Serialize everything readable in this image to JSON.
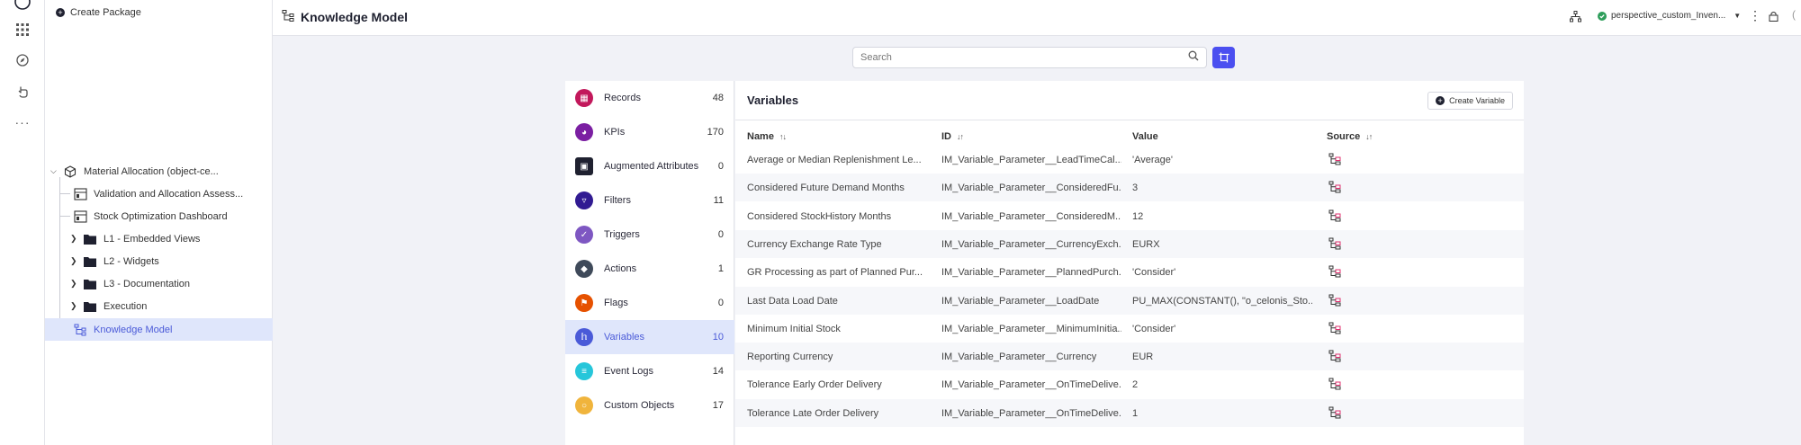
{
  "tree": {
    "create_package": "Create Package",
    "nodes": [
      "Material Allocation (object-ce...",
      "Validation and Allocation Assess...",
      "Stock Optimization Dashboard",
      "L1 - Embedded Views",
      "L2 - Widgets",
      "L3 - Documentation",
      "Execution",
      "Knowledge Model"
    ]
  },
  "header": {
    "title": "Knowledge Model",
    "environment": "perspective_custom_Inven..."
  },
  "search": {
    "placeholder": "Search"
  },
  "categories": [
    {
      "label": "Records",
      "count": "48",
      "color": "#c2185b",
      "icon": "records-icon"
    },
    {
      "label": "KPIs",
      "count": "170",
      "color": "#7b1fa2",
      "icon": "kpi-icon"
    },
    {
      "label": "Augmented Attributes",
      "count": "0",
      "color": "#1f2130",
      "icon": "augmented-attributes-icon"
    },
    {
      "label": "Filters",
      "count": "11",
      "color": "#311b92",
      "icon": "filter-icon"
    },
    {
      "label": "Triggers",
      "count": "0",
      "color": "#7e57c2",
      "icon": "trigger-icon"
    },
    {
      "label": "Actions",
      "count": "1",
      "color": "#3f4a5a",
      "icon": "action-icon"
    },
    {
      "label": "Flags",
      "count": "0",
      "color": "#e65100",
      "icon": "flag-icon"
    },
    {
      "label": "Variables",
      "count": "10",
      "color": "#4a5ad8",
      "icon": "variables-icon"
    },
    {
      "label": "Event Logs",
      "count": "14",
      "color": "#26c6da",
      "icon": "event-log-icon"
    },
    {
      "label": "Custom Objects",
      "count": "17",
      "color": "#f0b43c",
      "icon": "custom-object-icon"
    }
  ],
  "variables": {
    "title": "Variables",
    "create_label": "Create Variable",
    "columns": [
      "Name",
      "ID",
      "Value",
      "Source"
    ],
    "rows": [
      {
        "name": "Average or Median Replenishment Le...",
        "id": "IM_Variable_Parameter__LeadTimeCal...",
        "value": "'Average'"
      },
      {
        "name": "Considered Future Demand Months",
        "id": "IM_Variable_Parameter__ConsideredFu...",
        "value": "3"
      },
      {
        "name": "Considered StockHistory Months",
        "id": "IM_Variable_Parameter__ConsideredM...",
        "value": "12"
      },
      {
        "name": "Currency Exchange Rate Type",
        "id": "IM_Variable_Parameter__CurrencyExch...",
        "value": "EURX"
      },
      {
        "name": "GR Processing as part of Planned Pur...",
        "id": "IM_Variable_Parameter__PlannedPurch...",
        "value": "'Consider'"
      },
      {
        "name": "Last Data Load Date",
        "id": "IM_Variable_Parameter__LoadDate",
        "value": "PU_MAX(CONSTANT(), \"o_celonis_Sto..."
      },
      {
        "name": "Minimum Initial Stock",
        "id": "IM_Variable_Parameter__MinimumInitia...",
        "value": "'Consider'"
      },
      {
        "name": "Reporting Currency",
        "id": "IM_Variable_Parameter__Currency",
        "value": "EUR"
      },
      {
        "name": "Tolerance Early Order Delivery",
        "id": "IM_Variable_Parameter__OnTimeDelive...",
        "value": "2"
      },
      {
        "name": "Tolerance Late Order Delivery",
        "id": "IM_Variable_Parameter__OnTimeDelive...",
        "value": "1"
      }
    ]
  }
}
